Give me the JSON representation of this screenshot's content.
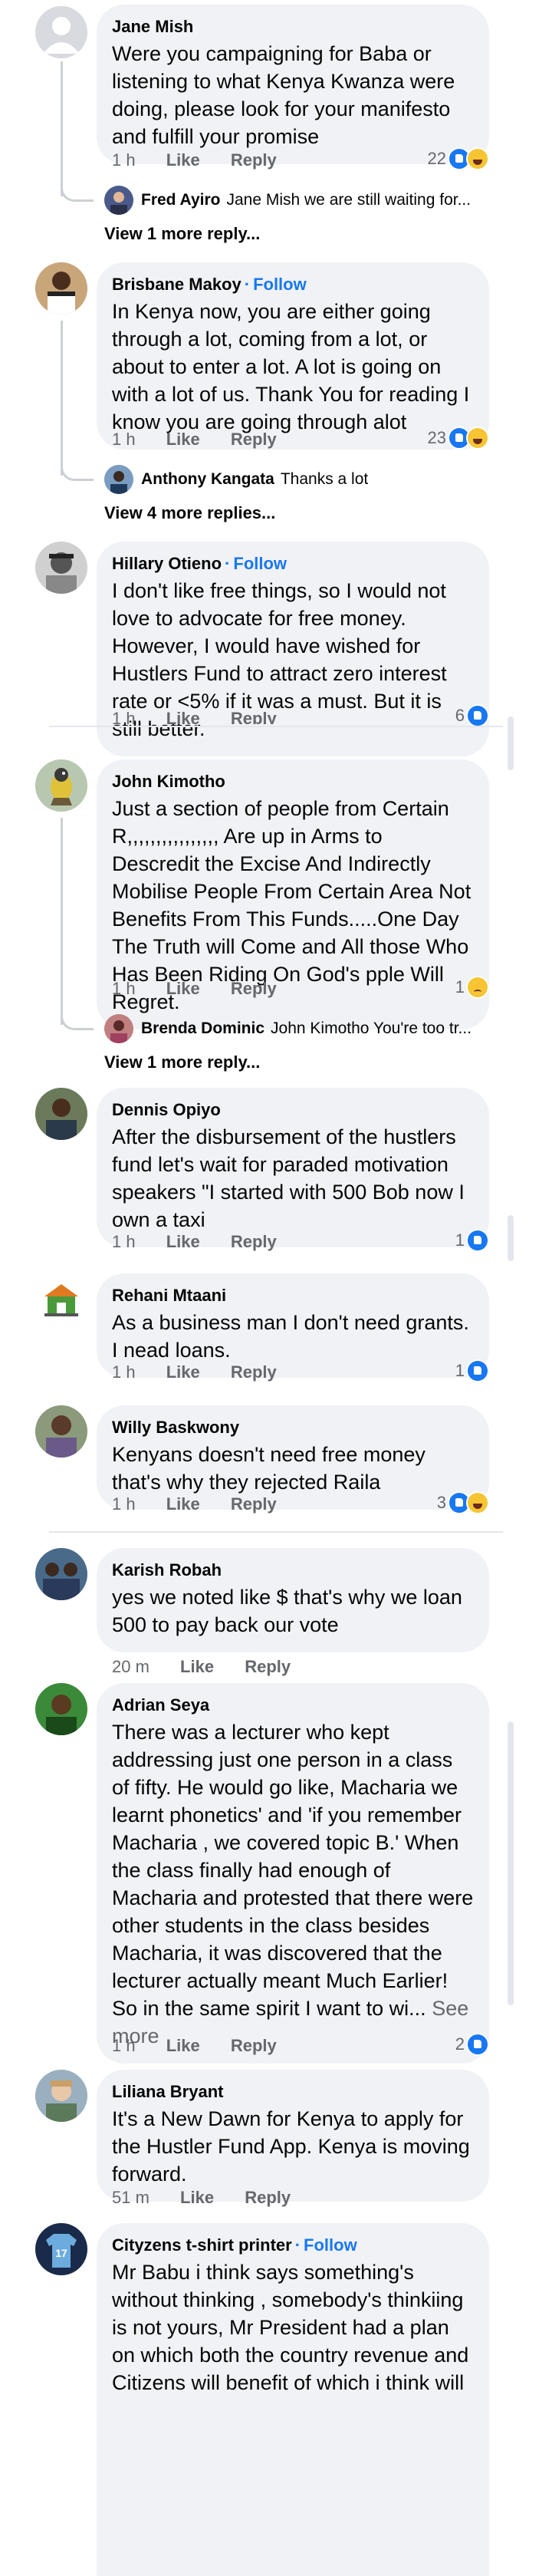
{
  "comments": [
    {
      "name": "Jane Mish",
      "follow": "",
      "text": "Were you campaigning for Baba or listening to what Kenya Kwanza were doing, please look for your manifesto and fulfill your promise",
      "time": "1 h",
      "like": "Like",
      "reply": "Reply",
      "count": "22",
      "reactions": [
        "like-icon",
        "haha-icon"
      ],
      "reply_preview": {
        "name": "Fred Ayiro",
        "text": "Jane Mish we are still waiting for..."
      },
      "view_more": "View 1 more reply..."
    },
    {
      "name": "Brisbane Makoy",
      "follow": "Follow",
      "text": "In Kenya now, you are either going through a lot, coming from a lot, or about to enter a lot. A lot is going on with a lot of us. Thank You for reading I know you are going through alot",
      "time": "1 h",
      "like": "Like",
      "reply": "Reply",
      "count": "23",
      "reactions": [
        "like-icon",
        "haha-icon"
      ],
      "reply_preview": {
        "name": "Anthony Kangata",
        "text": "Thanks a lot"
      },
      "view_more": "View 4 more replies..."
    },
    {
      "name": "Hillary Otieno",
      "follow": "Follow",
      "text": "I don't like free things, so I would not love to advocate for free money. However, I would have wished for Hustlers Fund to attract zero interest rate or <5% if it was a must. But it is still better.",
      "time": "1 h",
      "like": "Like",
      "reply": "Reply",
      "count": "6",
      "reactions": [
        "like-icon"
      ]
    },
    {
      "name": "John Kimotho",
      "follow": "",
      "text": "Just a section of people from Certain R,,,,,,,,,,,,,,,, Are up in Arms to Descredit the Excise And Indirectly Mobilise People From Certain Area Not Benefits From This Funds.....One Day The Truth will Come and All those Who Has Been Riding On God's pple Will Regret.",
      "time": "1 h",
      "like": "Like",
      "reply": "Reply",
      "count": "1",
      "reactions": [
        "sad-icon"
      ],
      "reply_preview": {
        "name": "Brenda Dominic",
        "text": "John Kimotho You're too tr..."
      },
      "view_more": "View 1 more reply..."
    },
    {
      "name": "Dennis Opiyo",
      "follow": "",
      "text": "After the disbursement of the hustlers fund let's wait for paraded motivation speakers \"I started with 500 Bob now I own a taxi",
      "time": "1 h",
      "like": "Like",
      "reply": "Reply",
      "count": "1",
      "reactions": [
        "like-icon"
      ]
    },
    {
      "name": "Rehani Mtaani",
      "follow": "",
      "text": "As a business man I don't need grants. I nead loans.",
      "time": "1 h",
      "like": "Like",
      "reply": "Reply",
      "count": "1",
      "reactions": [
        "like-icon"
      ]
    },
    {
      "name": "Willy Baskwony",
      "follow": "",
      "text": "Kenyans doesn't need free money that's why they rejected Raila",
      "time": "1 h",
      "like": "Like",
      "reply": "Reply",
      "count": "3",
      "reactions": [
        "like-icon",
        "haha-icon"
      ]
    },
    {
      "name": "Karish Robah",
      "follow": "",
      "text": "yes we noted like $ that's why we loan 500 to pay back our vote",
      "time": "20 m",
      "like": "Like",
      "reply": "Reply",
      "count": "",
      "reactions": []
    },
    {
      "name": "Adrian Seya",
      "follow": "",
      "text": "There was a lecturer who kept addressing just one person in a class of fifty. He would go like, Macharia we learnt phonetics' and 'if you remember Macharia , we covered topic B.' When the class finally had enough of Macharia and protested that there were other students in the class besides Macharia, it was discovered that the lecturer actually meant Much Earlier!\nSo in the same spirit I want to wi...",
      "see_more": "See more",
      "time": "1 h",
      "like": "Like",
      "reply": "Reply",
      "count": "2",
      "reactions": [
        "like-icon"
      ]
    },
    {
      "name": "Liliana Bryant",
      "follow": "",
      "text": "It's a New Dawn for Kenya to apply for the Hustler Fund App. Kenya is moving forward.",
      "time": "51 m",
      "like": "Like",
      "reply": "Reply",
      "count": "",
      "reactions": []
    },
    {
      "name": "Cityzens t-shirt printer",
      "follow": "Follow",
      "text": "Mr Babu i think  says something's without  thinking , somebody's  thinkiing is not yours,  Mr President  had a plan on which both the country revenue and Citizens  will benefit of which  i think will"
    }
  ],
  "jersey_number": "17"
}
